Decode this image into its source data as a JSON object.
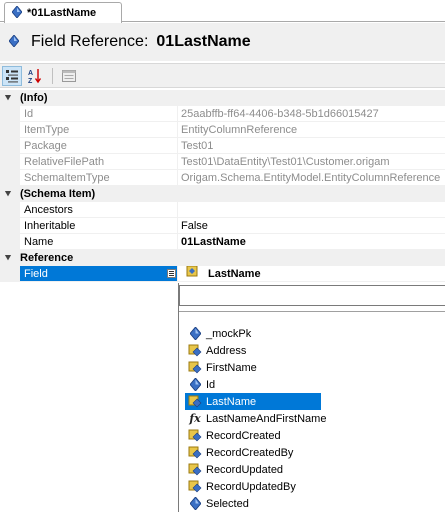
{
  "tab": {
    "title": "*01LastName",
    "icon": "field-reference-icon"
  },
  "header": {
    "label": "Field Reference:",
    "name": "01LastName",
    "icon": "field-reference-icon"
  },
  "toolbar": {
    "buttons": [
      "categorized-icon",
      "alphabetical-icon",
      "property-pages-icon"
    ]
  },
  "categories": [
    {
      "label": "(Info)",
      "rows": [
        {
          "name": "Id",
          "value": "25aabffb-ff64-4406-b348-5b1d66015427",
          "readonly": true
        },
        {
          "name": "ItemType",
          "value": "EntityColumnReference",
          "readonly": true
        },
        {
          "name": "Package",
          "value": "Test01",
          "readonly": true
        },
        {
          "name": "RelativeFilePath",
          "value": "Test01\\DataEntity\\Test01\\Customer.origam",
          "readonly": true
        },
        {
          "name": "SchemaItemType",
          "value": "Origam.Schema.EntityModel.EntityColumnReference",
          "readonly": true
        }
      ]
    },
    {
      "label": "(Schema Item)",
      "rows": [
        {
          "name": "Ancestors",
          "value": ""
        },
        {
          "name": "Inheritable",
          "value": "False"
        },
        {
          "name": "Name",
          "value": "01LastName",
          "bold": true
        }
      ]
    },
    {
      "label": "Reference",
      "rows": [
        {
          "name": "Field",
          "value": "LastName",
          "selected": true
        }
      ]
    }
  ],
  "dropdown": {
    "items": [
      {
        "label": "_mockPk",
        "icon": "pk-field-icon"
      },
      {
        "label": "Address",
        "icon": "field-icon"
      },
      {
        "label": "FirstName",
        "icon": "field-icon"
      },
      {
        "label": "Id",
        "icon": "pk-field-icon"
      },
      {
        "label": "LastName",
        "icon": "field-icon",
        "selected": true
      },
      {
        "label": "LastNameAndFirstName",
        "icon": "function-icon"
      },
      {
        "label": "RecordCreated",
        "icon": "field-icon"
      },
      {
        "label": "RecordCreatedBy",
        "icon": "field-icon"
      },
      {
        "label": "RecordUpdated",
        "icon": "field-icon"
      },
      {
        "label": "RecordUpdatedBy",
        "icon": "field-icon"
      },
      {
        "label": "Selected",
        "icon": "pk-field-icon"
      }
    ]
  },
  "colors": {
    "selection": "#0078d7",
    "category_bg": "#f0f0f0",
    "readonly_text": "#8d8d8d"
  }
}
